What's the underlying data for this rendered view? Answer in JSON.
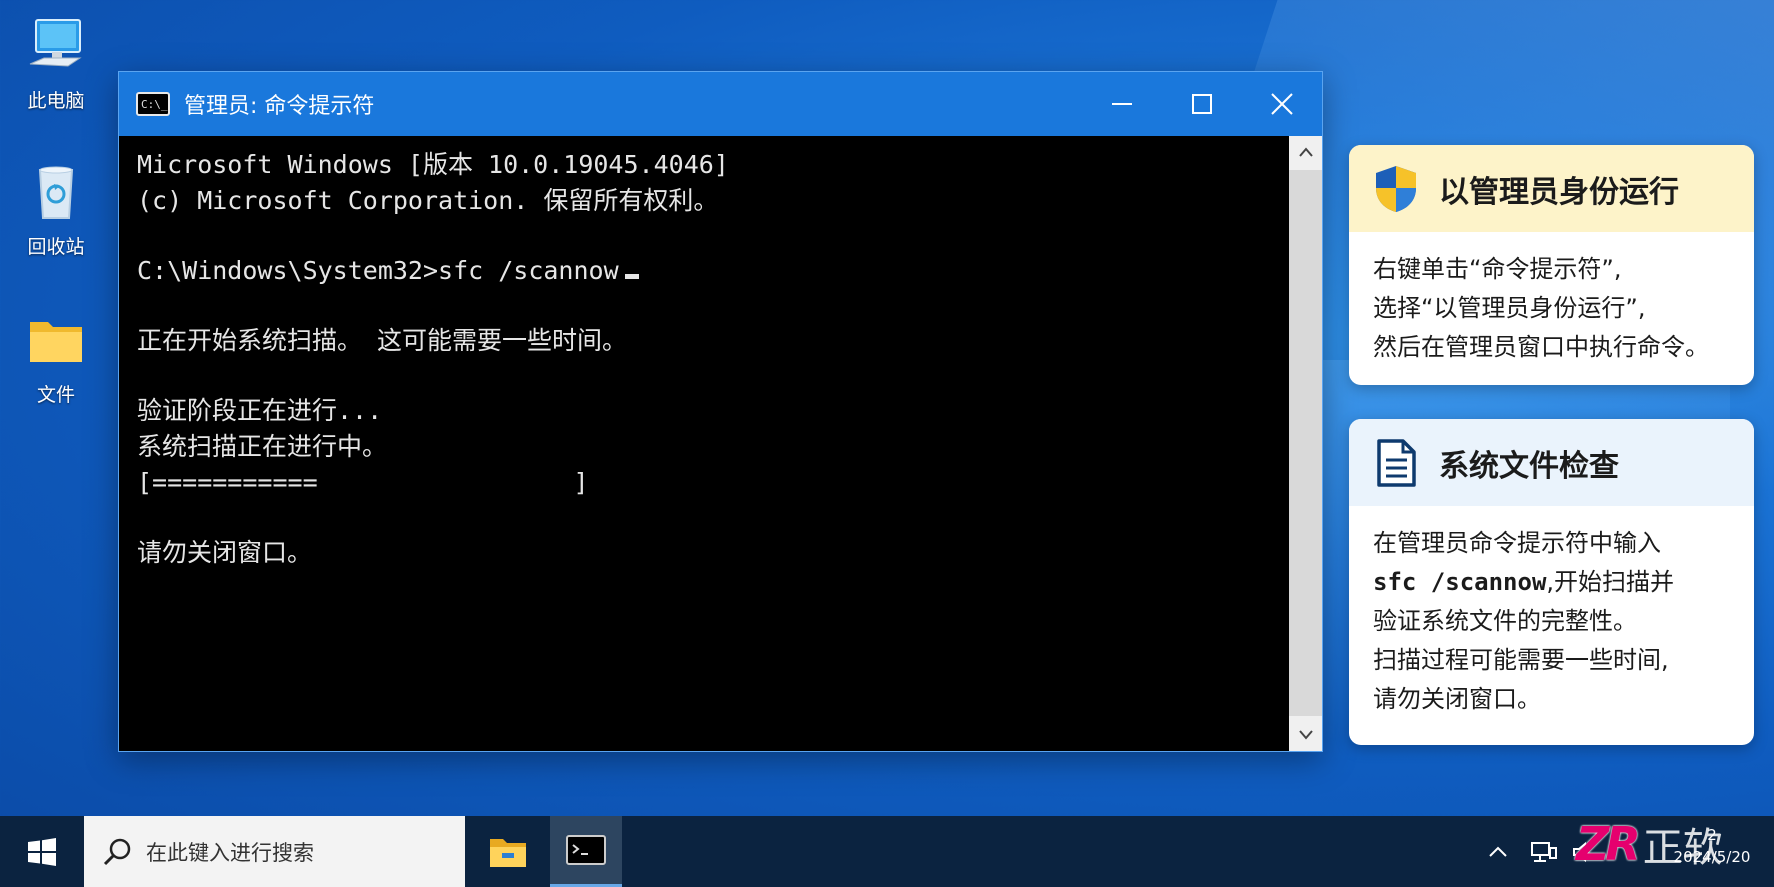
{
  "desktop": {
    "icons": [
      {
        "label": "此电脑"
      },
      {
        "label": "回收站"
      },
      {
        "label": "文件"
      }
    ]
  },
  "window": {
    "title": "管理员: 命令提示符",
    "console_lines": [
      "Microsoft Windows [版本 10.0.19045.4046]",
      "(c) Microsoft Corporation. 保留所有权利。",
      "C:\\Windows\\System32>sfc /scannow",
      "正在开始系统扫描。 这可能需要一些时间。",
      "验证阶段正在进行...",
      "系统扫描正在进行中。",
      "[===========                 ]",
      "请勿关闭窗口。"
    ]
  },
  "cards": {
    "admin": {
      "title": "以管理员身份运行",
      "lines": [
        "右键单击“命令提示符”,",
        "选择“以管理员身份运行”,",
        "然后在管理员窗口中执行命令。"
      ]
    },
    "sfc": {
      "title": "系统文件检查",
      "line1": "在管理员命令提示符中输入",
      "command": "sfc /scannow",
      "line2_rest": ",开始扫描并",
      "line3": "验证系统文件的完整性。",
      "line4": "扫描过程可能需要一些时间,",
      "line5": "请勿关闭窗口。"
    }
  },
  "taskbar": {
    "search_placeholder": "在此键入进行搜索",
    "clock_time": "2",
    "clock_date": "2024/5/20"
  },
  "watermark": {
    "logo": "ZR",
    "text": "正软"
  },
  "colors": {
    "titlebar": "#1a78dc",
    "console_bg": "#000000",
    "taskbar": "#0b2340",
    "card1_header": "#fdf3c9",
    "card2_header": "#eaf3fc",
    "watermark_logo": "#e5006e"
  }
}
